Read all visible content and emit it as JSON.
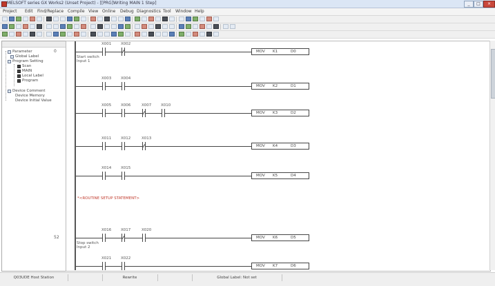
{
  "window": {
    "title": "MELSOFT series GX Works2 (Unset Project) - [[PRG]Writing MAIN 1 Step]",
    "controls": [
      "_",
      "□",
      "×"
    ]
  },
  "menubar": {
    "items": [
      "Project",
      "Edit",
      "Find/Replace",
      "Compile",
      "View",
      "Online",
      "Debug",
      "Diagnostics",
      "Tool",
      "Window",
      "Help"
    ]
  },
  "toolbar_rows": [
    {
      "label": "",
      "count": 30
    },
    {
      "label": "",
      "count": 32
    },
    {
      "label": "",
      "count": 30
    }
  ],
  "tree": {
    "header": "",
    "items": [
      {
        "label": "Parameter"
      },
      {
        "label": "Global Label"
      },
      {
        "label": "Program Setting"
      },
      {
        "label": "Scan"
      },
      {
        "label": "MAIN"
      },
      {
        "label": "Local Label"
      },
      {
        "label": "Program"
      },
      {
        "label": "Device Comment"
      },
      {
        "label": "Device Memory"
      },
      {
        "label": "Device Initial Value"
      }
    ]
  },
  "ladder": {
    "rungs": [
      {
        "step": "0",
        "contacts": [
          {
            "dev": "X001",
            "type": "no"
          },
          {
            "dev": "X002",
            "type": "nc"
          }
        ],
        "instr": [
          "MOV",
          "K1",
          "D0"
        ],
        "comment": [
          "Start switch",
          "Input 1"
        ]
      },
      {
        "step": "",
        "contacts": [
          {
            "dev": "X003",
            "type": "no"
          },
          {
            "dev": "X004",
            "type": "no"
          }
        ],
        "instr": [
          "MOV",
          "K2",
          "D1"
        ],
        "comment": []
      },
      {
        "step": "",
        "contacts": [
          {
            "dev": "X005",
            "type": "no"
          },
          {
            "dev": "X006",
            "type": "no"
          },
          {
            "dev": "X007",
            "type": "nc"
          },
          {
            "dev": "X010",
            "type": "no"
          }
        ],
        "instr": [
          "MOV",
          "K3",
          "D2"
        ],
        "comment": []
      },
      {
        "step": "",
        "contacts": [
          {
            "dev": "X011",
            "type": "no"
          },
          {
            "dev": "X012",
            "type": "no"
          },
          {
            "dev": "X013",
            "type": "nc"
          }
        ],
        "instr": [
          "MOV",
          "K4",
          "D3"
        ],
        "comment": []
      },
      {
        "step": "",
        "contacts": [
          {
            "dev": "X014",
            "type": "no"
          },
          {
            "dev": "X015",
            "type": "no"
          }
        ],
        "instr": [
          "MOV",
          "K5",
          "D4"
        ],
        "comment": []
      },
      {
        "step": "52",
        "contacts": [
          {
            "dev": "X016",
            "type": "no"
          },
          {
            "dev": "X017",
            "type": "nc"
          },
          {
            "dev": "X020",
            "type": "no"
          }
        ],
        "instr": [
          "MOV",
          "K6",
          "D5"
        ],
        "comment": [
          "Stop switch",
          "Input 2"
        ]
      },
      {
        "step": "",
        "contacts": [
          {
            "dev": "X021",
            "type": "no"
          },
          {
            "dev": "X022",
            "type": "no"
          }
        ],
        "instr": [
          "MOV",
          "K7",
          "D6"
        ],
        "comment": []
      }
    ],
    "statement": "*<ROUTINE SETUP STATEMENT>"
  },
  "status": {
    "cells": [
      "Q03UDE Host Station",
      "",
      "Rewrite",
      "",
      "Global Label: Not set"
    ]
  }
}
